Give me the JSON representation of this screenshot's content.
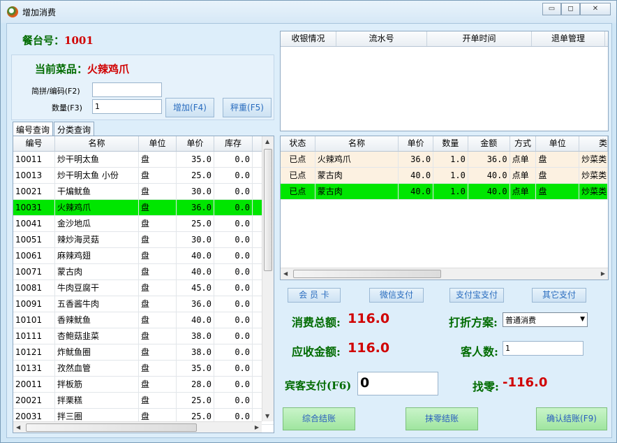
{
  "window": {
    "title": "增加消费",
    "min_icon": "minimize-icon",
    "max_icon": "maximize-icon",
    "close_icon": "close-icon"
  },
  "table_info": {
    "label": "餐台号：",
    "value": "1001"
  },
  "current_dish": {
    "label": "当前菜品：",
    "value": "火辣鸡爪"
  },
  "code_field": {
    "label": "简拼/编码(F2)",
    "value": ""
  },
  "qty_field": {
    "label": "数量(F3)",
    "value": "1"
  },
  "buttons": {
    "add": "增加(F4)",
    "weigh": "秤重(F5)"
  },
  "tabs": [
    "编号查询",
    "分类查询"
  ],
  "dish_grid": {
    "headers": [
      "编号",
      "名称",
      "单位",
      "单价",
      "库存"
    ],
    "rows": [
      [
        "10011",
        "炒干明太鱼",
        "盘",
        "35.0",
        "0.0"
      ],
      [
        "10013",
        "炒干明太鱼 小份",
        "盘",
        "25.0",
        "0.0"
      ],
      [
        "10021",
        "干煸鱿鱼",
        "盘",
        "30.0",
        "0.0"
      ],
      [
        "10031",
        "火辣鸡爪",
        "盘",
        "36.0",
        "0.0"
      ],
      [
        "10041",
        "金沙地瓜",
        "盘",
        "25.0",
        "0.0"
      ],
      [
        "10051",
        "辣炒海灵菇",
        "盘",
        "30.0",
        "0.0"
      ],
      [
        "10061",
        "麻辣鸡翅",
        "盘",
        "40.0",
        "0.0"
      ],
      [
        "10071",
        "蒙古肉",
        "盘",
        "40.0",
        "0.0"
      ],
      [
        "10081",
        "牛肉豆腐干",
        "盘",
        "45.0",
        "0.0"
      ],
      [
        "10091",
        "五香酱牛肉",
        "盘",
        "36.0",
        "0.0"
      ],
      [
        "10101",
        "香辣鱿鱼",
        "盘",
        "40.0",
        "0.0"
      ],
      [
        "10111",
        "杏鲍菇韭菜",
        "盘",
        "38.0",
        "0.0"
      ],
      [
        "10121",
        "炸鱿鱼圈",
        "盘",
        "38.0",
        "0.0"
      ],
      [
        "10131",
        "孜然血管",
        "盘",
        "35.0",
        "0.0"
      ],
      [
        "20011",
        "拌板筋",
        "盘",
        "28.0",
        "0.0"
      ],
      [
        "20021",
        "拌栗糕",
        "盘",
        "25.0",
        "0.0"
      ],
      [
        "20031",
        "拌三圈",
        "盘",
        "25.0",
        "0.0"
      ]
    ],
    "selected_index": 3
  },
  "cashier_grid": {
    "headers": [
      "收银情况",
      "流水号",
      "开单时间",
      "退单管理"
    ]
  },
  "order_grid": {
    "headers": [
      "状态",
      "名称",
      "单价",
      "数量",
      "金额",
      "方式",
      "单位",
      "类"
    ],
    "rows": [
      [
        "已点",
        "火辣鸡爪",
        "36.0",
        "1.0",
        "36.0",
        "点单",
        "盘",
        "炒菜类"
      ],
      [
        "已点",
        "蒙古肉",
        "40.0",
        "1.0",
        "40.0",
        "点单",
        "盘",
        "炒菜类"
      ],
      [
        "已点",
        "蒙古肉",
        "40.0",
        "1.0",
        "40.0",
        "点单",
        "盘",
        "炒菜类"
      ]
    ],
    "selected_index": 2
  },
  "payment_buttons": [
    "会 员 卡",
    "微信支付",
    "支付宝支付",
    "其它支付"
  ],
  "summary": {
    "total_label": "消费总额:",
    "total_value": "116.0",
    "due_label": "应收金额:",
    "due_value": "116.0",
    "discount_label": "打折方案:",
    "discount_value": "普通消费",
    "guests_label": "客人数:",
    "guests_value": "1",
    "pay_label": "宾客支付(F6)",
    "pay_value": "0",
    "change_label": "找零:",
    "change_value": "-116.0"
  },
  "bottom_buttons": {
    "combined": "综合结账",
    "round": "抹零结账",
    "confirm": "确认结账(F9)"
  }
}
